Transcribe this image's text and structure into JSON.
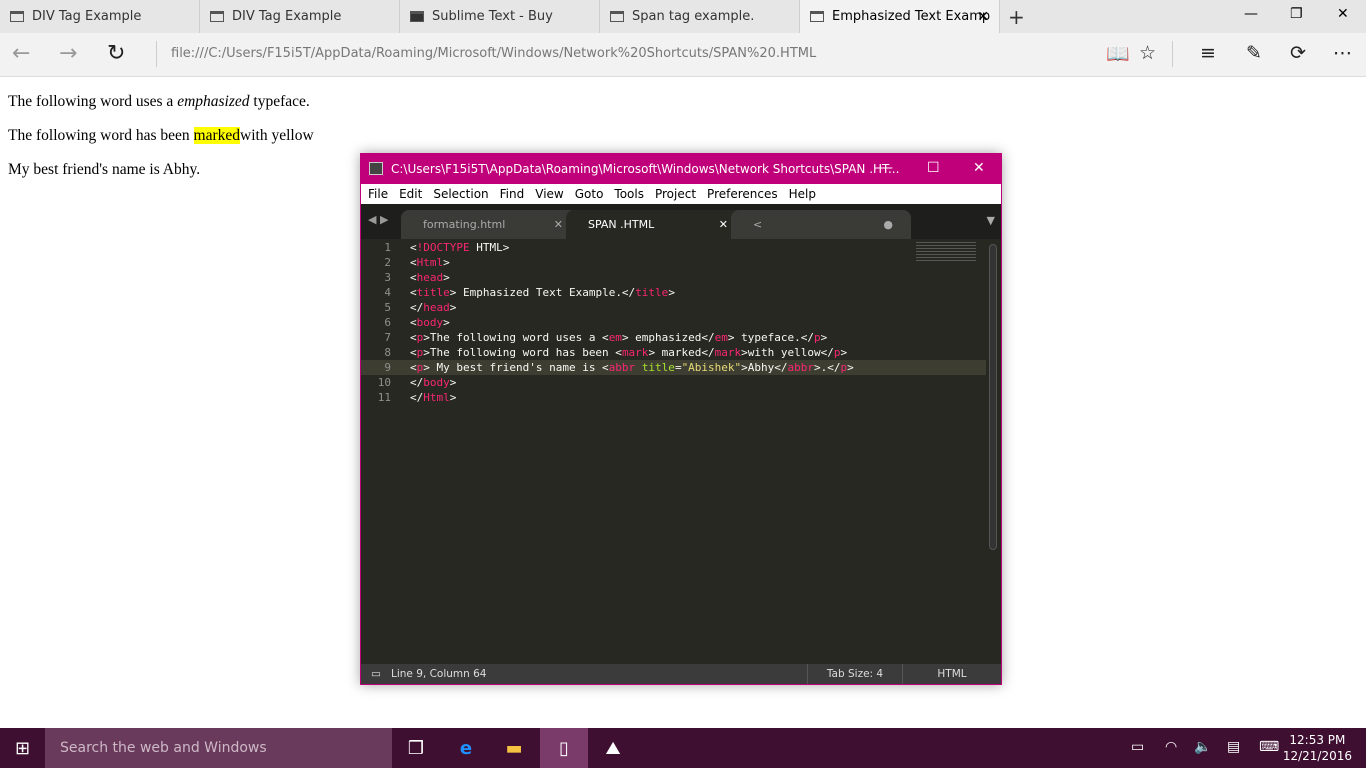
{
  "browser": {
    "tabs": [
      {
        "label": "DIV Tag Example"
      },
      {
        "label": "DIV Tag Example"
      },
      {
        "label": "Sublime Text - Buy"
      },
      {
        "label": "Span tag example."
      },
      {
        "label": "Emphasized Text Examp",
        "active": true
      }
    ],
    "url": "file:///C:/Users/F15i5T/AppData/Roaming/Microsoft/Windows/Network%20Shortcuts/SPAN%20.HTML"
  },
  "page": {
    "p1_before": "The following word uses a ",
    "p1_em": "emphasized",
    "p1_after": " typeface.",
    "p2_before": "The following word has been ",
    "p2_mark": "marked",
    "p2_after": "with yellow",
    "p3": "My best friend's name is Abhy."
  },
  "editor": {
    "title": "C:\\Users\\F15i5T\\AppData\\Roaming\\Microsoft\\Windows\\Network Shortcuts\\SPAN .HT...",
    "menu": [
      "File",
      "Edit",
      "Selection",
      "Find",
      "View",
      "Goto",
      "Tools",
      "Project",
      "Preferences",
      "Help"
    ],
    "tabs": [
      {
        "label": "formating.html"
      },
      {
        "label": "SPAN .HTML"
      },
      {
        "label": "<"
      }
    ],
    "current_line": 9,
    "lines": [
      [
        [
          "<",
          "t"
        ],
        [
          "!DOCTYPE",
          "k"
        ],
        [
          " HTML>",
          "t"
        ]
      ],
      [
        [
          "<",
          "t"
        ],
        [
          "Html",
          "k"
        ],
        [
          ">",
          "t"
        ]
      ],
      [
        [
          "<",
          "t"
        ],
        [
          "head",
          "k"
        ],
        [
          ">",
          "t"
        ]
      ],
      [
        [
          "<",
          "t"
        ],
        [
          "title",
          "k"
        ],
        [
          "> Emphasized Text Example.</",
          "t"
        ],
        [
          "title",
          "k"
        ],
        [
          ">",
          "t"
        ]
      ],
      [
        [
          "</",
          "t"
        ],
        [
          "head",
          "k"
        ],
        [
          ">",
          "t"
        ]
      ],
      [
        [
          "<",
          "t"
        ],
        [
          "body",
          "k"
        ],
        [
          ">",
          "t"
        ]
      ],
      [
        [
          "<",
          "t"
        ],
        [
          "p",
          "k"
        ],
        [
          ">The following word uses a <",
          "t"
        ],
        [
          "em",
          "k"
        ],
        [
          "> emphasized</",
          "t"
        ],
        [
          "em",
          "k"
        ],
        [
          "> typeface.</",
          "t"
        ],
        [
          "p",
          "k"
        ],
        [
          ">",
          "t"
        ]
      ],
      [
        [
          "<",
          "t"
        ],
        [
          "p",
          "k"
        ],
        [
          ">The following word has been <",
          "t"
        ],
        [
          "mark",
          "k"
        ],
        [
          "> marked</",
          "t"
        ],
        [
          "mark",
          "k"
        ],
        [
          ">with yellow</",
          "t"
        ],
        [
          "p",
          "k"
        ],
        [
          ">",
          "t"
        ]
      ],
      [
        [
          "<",
          "t"
        ],
        [
          "p",
          "k"
        ],
        [
          "> My best friend's name is <",
          "t"
        ],
        [
          "abbr",
          "k"
        ],
        [
          " ",
          "t"
        ],
        [
          "title",
          "a"
        ],
        [
          "=",
          "t"
        ],
        [
          "\"Abishek\"",
          "s"
        ],
        [
          ">Abhy</",
          "t"
        ],
        [
          "abbr",
          "k"
        ],
        [
          ">.</",
          "t"
        ],
        [
          "p",
          "k"
        ],
        [
          ">",
          "t"
        ]
      ],
      [
        [
          "</",
          "t"
        ],
        [
          "body",
          "k"
        ],
        [
          ">",
          "t"
        ]
      ],
      [
        [
          "</",
          "t"
        ],
        [
          "Html",
          "k"
        ],
        [
          ">",
          "t"
        ]
      ]
    ],
    "status": {
      "position": "Line 9, Column 64",
      "tab_size": "Tab Size: 4",
      "syntax": "HTML"
    }
  },
  "taskbar": {
    "search_placeholder": "Search the web and Windows",
    "time": "12:53 PM",
    "date": "12/21/2016"
  }
}
